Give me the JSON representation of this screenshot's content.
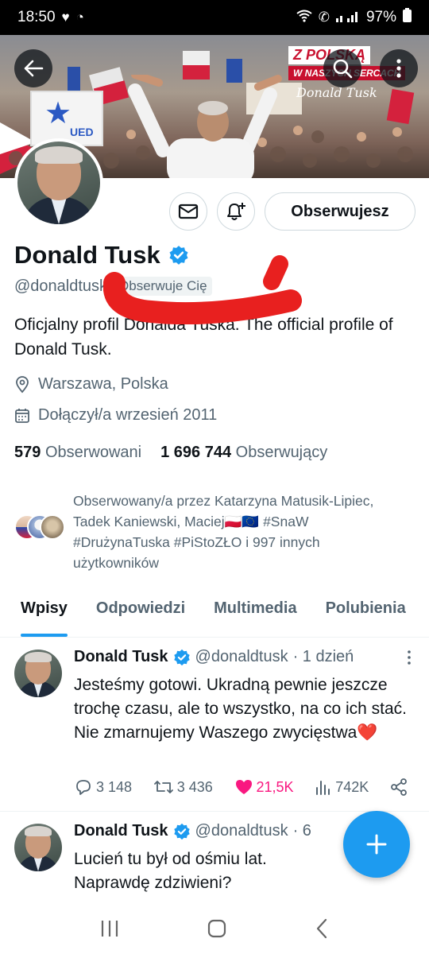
{
  "status_bar": {
    "time": "18:50",
    "battery": "97%"
  },
  "banner": {
    "sign_text": "UED",
    "logo_line1": "Z POLSKĄ",
    "logo_line2": "W NASZYCH SERCACH",
    "logo_signature": "Donald Tusk"
  },
  "profile": {
    "name": "Donald Tusk",
    "handle": "@donaldtusk",
    "follows_you": "Obserwuje Cię",
    "bio": "Oficjalny profil Donalda Tuska. The official profile of Donald Tusk.",
    "location": "Warszawa, Polska",
    "joined": "Dołączył/a wrzesień 2011",
    "following_count": "579",
    "following_label": "Obserwowani",
    "followers_count": "1 696 744",
    "followers_label": "Obserwujący",
    "follow_button": "Obserwujesz",
    "followed_by": "Obserwowany/a przez Katarzyna Matusik-Lipiec, Tadek Kaniewski, Maciej🇵🇱🇪🇺 #SnaW #DrużynaTuska #PiStoZŁO i 997 innych użytkowników"
  },
  "tabs": [
    {
      "label": "Wpisy"
    },
    {
      "label": "Odpowiedzi"
    },
    {
      "label": "Multimedia"
    },
    {
      "label": "Polubienia"
    }
  ],
  "tweets": [
    {
      "name": "Donald Tusk",
      "handle": "@donaldtusk",
      "time": "· 1 dzień",
      "text": "Jesteśmy gotowi. Ukradną pewnie jeszcze trochę czasu, ale to wszystko, na co ich stać. Nie zmarnujemy Waszego zwycięstwa❤️",
      "replies": "3 148",
      "retweets": "3 436",
      "likes": "21,5K",
      "views": "742K"
    },
    {
      "name": "Donald Tusk",
      "handle": "@donaldtusk",
      "time": "· 6",
      "text": "Lucień tu był od ośmiu lat. Naprawdę zdziwieni?"
    }
  ],
  "colors": {
    "accent": "#1d9bf0",
    "like": "#f91880",
    "muted": "#536471"
  }
}
